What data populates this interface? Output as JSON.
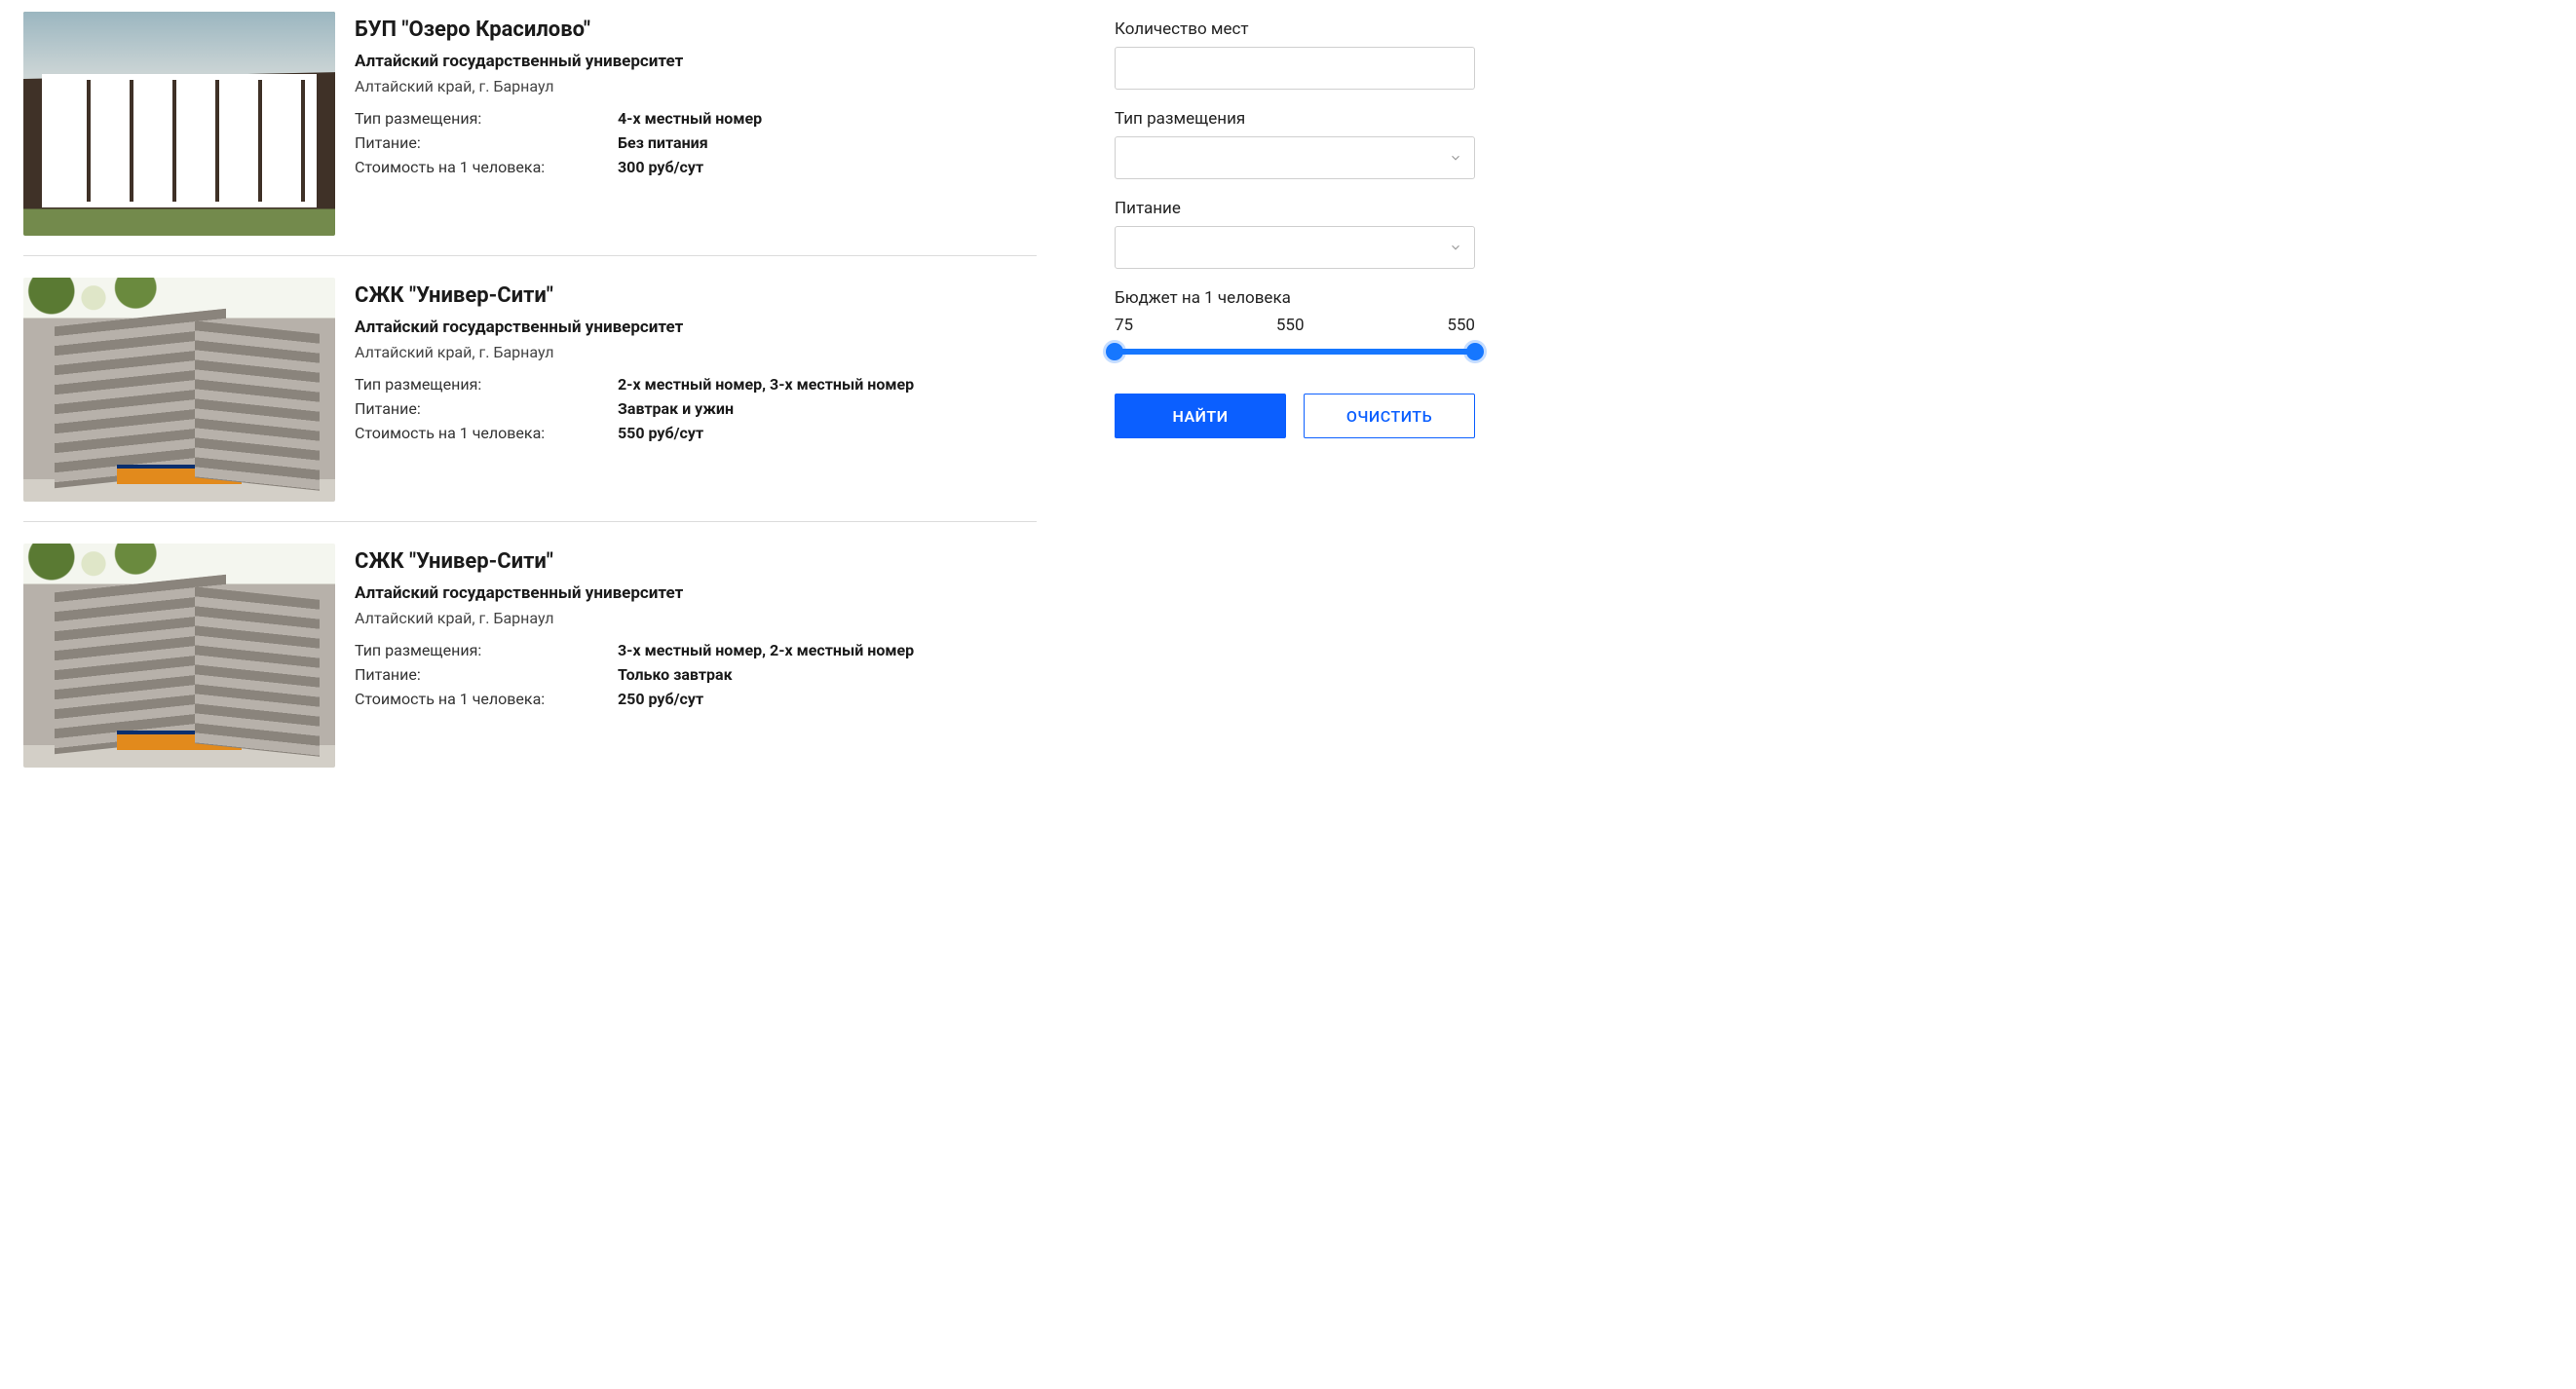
{
  "labels": {
    "type": "Тип размещения:",
    "meal": "Питание:",
    "price": "Стоимость на 1 человека:"
  },
  "results": [
    {
      "title": "БУП \"Озеро Красилово\"",
      "org": "Алтайский государственный университет",
      "location": "Алтайский край, г. Барнаул",
      "type": "4-х местный номер",
      "meal": "Без питания",
      "price": "300 руб/сут",
      "image_kind": "house"
    },
    {
      "title": "СЖК \"Универ-Сити\"",
      "org": "Алтайский государственный университет",
      "location": "Алтайский край, г. Барнаул",
      "type": "2-х местный номер, 3-х местный номер",
      "meal": "Завтрак и ужин",
      "price": "550 руб/сут",
      "image_kind": "building"
    },
    {
      "title": "СЖК \"Универ-Сити\"",
      "org": "Алтайский государственный университет",
      "location": "Алтайский край, г. Барнаул",
      "type": "3-х местный номер, 2-х местный номер",
      "meal": "Только завтрак",
      "price": "250 руб/сут",
      "image_kind": "building"
    }
  ],
  "sidebar": {
    "seats_label": "Количество мест",
    "seats_value": "",
    "type_label": "Тип размещения",
    "type_value": "",
    "meal_label": "Питание",
    "meal_value": "",
    "budget_label": "Бюджет на 1 человека",
    "budget_min": "75",
    "budget_mid": "550",
    "budget_max": "550",
    "find_label": "НАЙТИ",
    "clear_label": "ОЧИСТИТЬ"
  }
}
